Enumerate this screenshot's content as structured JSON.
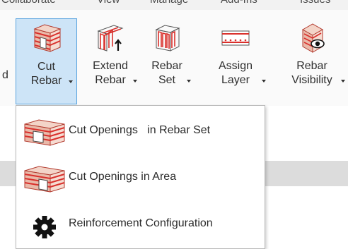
{
  "menubar": {
    "tabs": [
      "Collaborate",
      "View",
      "Manage",
      "Add-Ins",
      "Issues"
    ]
  },
  "ribbon": {
    "partial_label": "d",
    "buttons": [
      {
        "line1": "Cut",
        "line2": "Rebar",
        "icon": "cut-rebar-icon",
        "active": true
      },
      {
        "line1": "Extend",
        "line2": "Rebar",
        "icon": "extend-rebar-icon",
        "active": false
      },
      {
        "line1": "Rebar",
        "line2": "Set",
        "icon": "rebar-set-icon",
        "active": false
      },
      {
        "line1": "Assign",
        "line2": "Layer",
        "icon": "assign-layer-icon",
        "active": false
      },
      {
        "line1": "Rebar",
        "line2": "Visibility",
        "icon": "rebar-visibility-icon",
        "active": false
      }
    ]
  },
  "dropdown": {
    "items": [
      {
        "label": "Cut Openings   in Rebar Set",
        "icon": "cut-openings-rebar-set-icon"
      },
      {
        "label": "Cut Openings in Area",
        "icon": "cut-openings-area-icon"
      },
      {
        "label": "Reinforcement Configuration",
        "icon": "gear-icon"
      }
    ]
  },
  "colors": {
    "active_bg": "#cde4f7",
    "active_border": "#5aa4de",
    "rebar_red": "#d9302c",
    "wall_fill": "#e9b9a9",
    "panel_strip": "#dcdcdc"
  }
}
